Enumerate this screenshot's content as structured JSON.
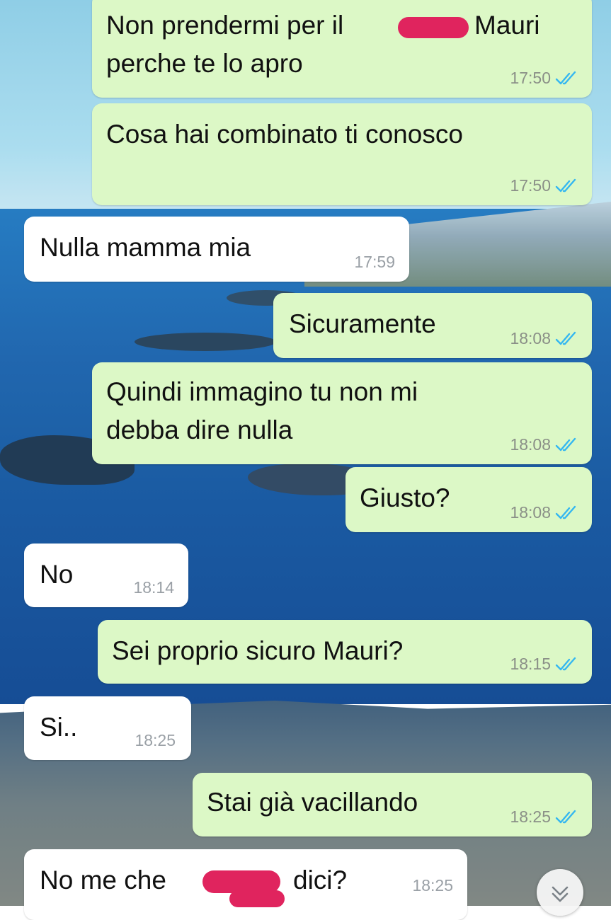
{
  "conversation": {
    "messages": [
      {
        "direction": "outgoing",
        "text_before": "Non prendermi per il",
        "text_after": "Mauri",
        "text_line2": "perche te lo apro",
        "time": "17:50",
        "status": "read"
      },
      {
        "direction": "outgoing",
        "text": "Cosa hai combinato ti conosco",
        "time": "17:50",
        "status": "read"
      },
      {
        "direction": "incoming",
        "text": "Nulla mamma mia",
        "time": "17:59"
      },
      {
        "direction": "outgoing",
        "text": "Sicuramente",
        "time": "18:08",
        "status": "read"
      },
      {
        "direction": "outgoing",
        "text_line1": "Quindi immagino tu non mi",
        "text_line2": "debba dire nulla",
        "time": "18:08",
        "status": "read"
      },
      {
        "direction": "outgoing",
        "text": "Giusto?",
        "time": "18:08",
        "status": "read"
      },
      {
        "direction": "incoming",
        "text": "No",
        "time": "18:14"
      },
      {
        "direction": "outgoing",
        "text": "Sei proprio sicuro Mauri?",
        "time": "18:15",
        "status": "read"
      },
      {
        "direction": "incoming",
        "text": "Si..",
        "time": "18:25"
      },
      {
        "direction": "outgoing",
        "text": "Stai già vacillando",
        "time": "18:25",
        "status": "read"
      },
      {
        "direction": "incoming",
        "text_before": "No me che",
        "text_after": "dici?",
        "time": "18:25"
      }
    ]
  },
  "icons": {
    "read_receipt": "double-check-icon",
    "scroll_down": "chevron-double-down-icon"
  },
  "colors": {
    "outgoing_bubble": "#dcf8c6",
    "incoming_bubble": "#ffffff",
    "read_tick": "#34b7f1",
    "redaction": "#e0245e"
  }
}
